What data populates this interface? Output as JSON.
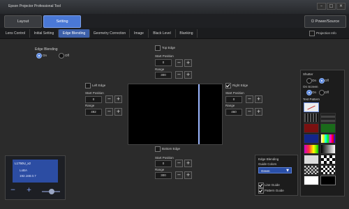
{
  "window": {
    "title": "Epson Projector Professional Tool"
  },
  "topbar": {
    "layout": "Layout",
    "setting": "Setting",
    "power": "Power/Source"
  },
  "tabs": [
    "Lens Control",
    "Initial Setting",
    "Edge Blending",
    "Geometry Correction",
    "Image",
    "Black Level",
    "Blanking"
  ],
  "projection_info": "Projection Info",
  "edge_blending": {
    "label": "Edge Blending",
    "on": "On",
    "off": "Off"
  },
  "top_edge": {
    "label": "Top Edge",
    "start_label": "Start Position",
    "start": "0",
    "range_label": "Range",
    "range": "300"
  },
  "left_edge": {
    "label": "Left Edge",
    "start_label": "Start Position",
    "start": "0",
    "range_label": "Range",
    "range": "492"
  },
  "right_edge": {
    "label": "Right Edge",
    "start_label": "Start Position",
    "start": "0",
    "range_label": "Range",
    "range": "460"
  },
  "bottom_edge": {
    "label": "Bottom Edge",
    "start_label": "Start Position",
    "start": "0",
    "range_label": "Range",
    "range": "300"
  },
  "mini": {
    "model": "L1750U_x2",
    "name": "LoBA",
    "ip": "192.168.0.7"
  },
  "side": {
    "shutter": "Shutter",
    "on": "On",
    "off": "Off",
    "on_screen": "On Screen",
    "on2": "On",
    "off2": "Off",
    "test_pattern": "Test Pattern"
  },
  "guide": {
    "title": "Edge Blending",
    "sub": "Guide Colors",
    "color": "Green",
    "line_guide": "Line Guide",
    "pattern_guide": "Pattern Guide"
  }
}
